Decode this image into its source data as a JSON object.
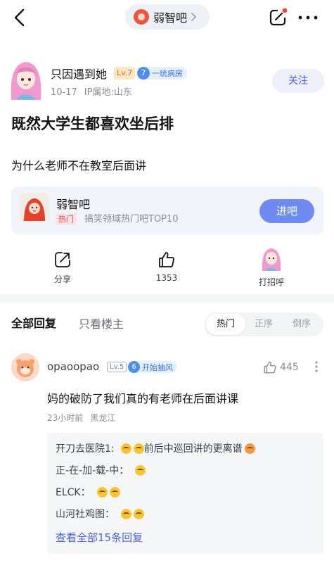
{
  "topbar": {
    "bar_name": "弱智吧",
    "icons": [
      "back-icon",
      "chevron-right-icon",
      "edit-icon",
      "more-icon"
    ],
    "notification_dot_color": "#f0463e"
  },
  "post": {
    "author": {
      "name": "只因遇到她",
      "level": "Lv.7",
      "badge_number": "7",
      "badge_text": "一统病房",
      "date": "10-17",
      "ip_location": "IP属地:山东"
    },
    "follow_label": "关注",
    "title": "既然大学生都喜欢坐后排",
    "body": "为什么老师不在教室后面讲"
  },
  "bar_card": {
    "name": "弱智吧",
    "tag": "热门",
    "description": "搞笑领域热门吧TOP10",
    "enter_label": "进吧"
  },
  "actions": {
    "share_label": "分享",
    "like_count": "1353",
    "greet_label": "打招呼"
  },
  "tabs": {
    "all_replies": "全部回复",
    "only_op": "只看楼主",
    "sort_options": [
      "热门",
      "正序",
      "倒序"
    ],
    "active_sort": "热门"
  },
  "comment": {
    "username": "opaoopao",
    "level": "Lv.5",
    "badge_number": "6",
    "badge_text": "开始抽风",
    "likes": "445",
    "text": "妈的破防了我们真的有老师在后面讲课",
    "time": "23小时前",
    "location": "黑龙江",
    "replies": [
      {
        "user": "开刀去医院1:",
        "text": "前后中巡回讲的更离谱"
      },
      {
        "user": "正-在-加-载-中：",
        "text": ""
      },
      {
        "user": "ELCK：",
        "text": ""
      },
      {
        "user": "山河社鸡图：",
        "text": ""
      }
    ],
    "view_all_label": "查看全部15条回复"
  },
  "colors": {
    "accent": "#4a61d8",
    "enter_button": "#6f8bf2",
    "hot_tag": "#e5484d"
  }
}
